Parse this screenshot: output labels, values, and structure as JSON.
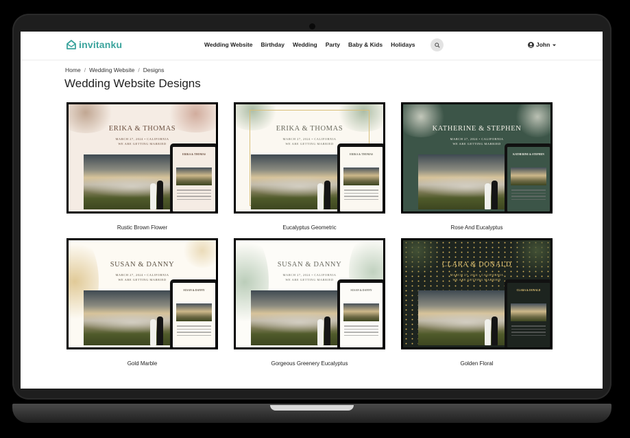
{
  "brand": {
    "name": "invitanku",
    "color": "#3aa39c"
  },
  "nav": {
    "items": [
      "Wedding Website",
      "Birthday",
      "Wedding",
      "Party",
      "Baby & Kids",
      "Holidays"
    ],
    "user": "John"
  },
  "breadcrumb": {
    "home": "Home",
    "section": "Wedding Website",
    "current": "Designs",
    "sep": "/"
  },
  "page": {
    "title": "Wedding Website Designs"
  },
  "designs": [
    {
      "name": "Rustic Brown Flower",
      "couple": "ERIKA & THOMAS",
      "date_line": "MARCH 27, 2024 • CALIFORNIA",
      "tagline": "WE ARE GETTING MARRIED",
      "tablet_couple": "ERIKA & THOMAS",
      "bg": "#f5ece4",
      "text_color": "#6b4f3f",
      "accent": "#b48c6e"
    },
    {
      "name": "Eucalyptus Geometric",
      "couple": "ERIKA & THOMAS",
      "date_line": "MARCH 27, 2024 • CALIFORNIA",
      "tagline": "WE ARE GETTING MARRIED",
      "tablet_couple": "ERIKA & THOMAS",
      "bg": "#fbf8f1",
      "text_color": "#6a6a5e",
      "accent": "#d9c07a"
    },
    {
      "name": "Rose And Eucalyptus",
      "couple": "KATHERINE & STEPHEN",
      "date_line": "MARCH 27, 2024 • CALIFORNIA",
      "tagline": "WE ARE GETTING MARRIED",
      "tablet_couple": "KATHERINE & STEPHEN",
      "bg": "#3c5548",
      "text_color": "#f1efe6",
      "accent": "#e9e6d6"
    },
    {
      "name": "Gold Marble",
      "couple": "SUSAN & DANNY",
      "date_line": "MARCH 27, 2024 • CALIFORNIA",
      "tagline": "WE ARE GETTING MARRIED",
      "tablet_couple": "SUSAN & DANNY",
      "bg": "#fdfaf3",
      "text_color": "#5e5447",
      "accent": "#c9a24c"
    },
    {
      "name": "Gorgeous Greenery Eucalyptus",
      "couple": "SUSAN & DANNY",
      "date_line": "MARCH 27, 2024 • CALIFORNIA",
      "tagline": "WE ARE GETTING MARRIED",
      "tablet_couple": "SUSAN & DANNY",
      "bg": "#fdfcf8",
      "text_color": "#6b6b62",
      "accent": "#8fae90"
    },
    {
      "name": "Golden Floral",
      "couple": "CLARA & DONALD",
      "date_line": "MARCH 27, 2024 • CALIFORNIA",
      "tagline": "WE ARE GETTING MARRIED",
      "tablet_couple": "CLARA & DONALD",
      "bg": "#1d241f",
      "text_color": "#e2c576",
      "accent": "#c9a24c"
    }
  ]
}
